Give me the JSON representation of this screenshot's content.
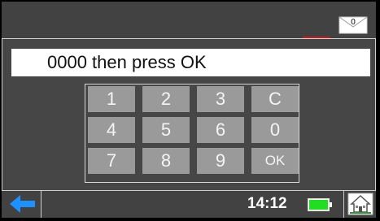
{
  "status": {
    "message_count": "0",
    "time": "14:12",
    "battery_level": 1.0,
    "battery_color": "#22dd22"
  },
  "prompt": {
    "text": "0000 then press OK"
  },
  "keypad": {
    "keys": [
      {
        "label": "1",
        "name": "key-1"
      },
      {
        "label": "2",
        "name": "key-2"
      },
      {
        "label": "3",
        "name": "key-3"
      },
      {
        "label": "C",
        "name": "key-clear"
      },
      {
        "label": "4",
        "name": "key-4"
      },
      {
        "label": "5",
        "name": "key-5"
      },
      {
        "label": "6",
        "name": "key-6"
      },
      {
        "label": "0",
        "name": "key-0"
      },
      {
        "label": "7",
        "name": "key-7"
      },
      {
        "label": "8",
        "name": "key-8"
      },
      {
        "label": "9",
        "name": "key-9"
      },
      {
        "label": "OK",
        "name": "key-ok"
      }
    ]
  },
  "icons": {
    "mail": "envelope-icon",
    "back": "back-arrow-icon",
    "battery": "battery-icon",
    "home": "home-icon"
  },
  "colors": {
    "background": "#464646",
    "key": "#9a9a9a",
    "back_arrow": "#1e90ff"
  }
}
